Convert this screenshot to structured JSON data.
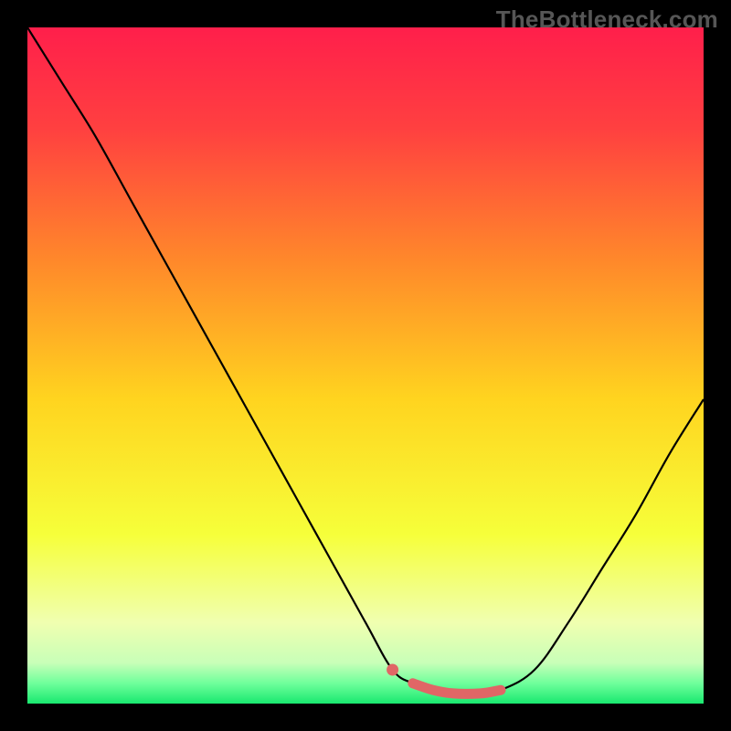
{
  "watermark": "TheBottleneck.com",
  "chart_data": {
    "type": "line",
    "title": "",
    "xlabel": "",
    "ylabel": "",
    "xlim": [
      0,
      100
    ],
    "ylim": [
      0,
      100
    ],
    "grid": false,
    "legend": false,
    "series": [
      {
        "name": "curve",
        "x": [
          0,
          5,
          10,
          15,
          20,
          25,
          30,
          35,
          40,
          45,
          50,
          54,
          57,
          60,
          63,
          67,
          70,
          75,
          80,
          85,
          90,
          95,
          100
        ],
        "values": [
          100,
          92,
          84,
          75,
          66,
          57,
          48,
          39,
          30,
          21,
          12,
          5,
          3,
          2,
          1.5,
          1.5,
          2,
          5,
          12,
          20,
          28,
          37,
          45
        ]
      },
      {
        "name": "marker-dot",
        "x": [
          54
        ],
        "values": [
          5
        ]
      },
      {
        "name": "marker-segment",
        "x": [
          57,
          60,
          63,
          67,
          70
        ],
        "values": [
          3,
          2,
          1.5,
          1.5,
          2
        ]
      }
    ],
    "gradient_stops": [
      {
        "offset": 0,
        "color": "#ff1f4b"
      },
      {
        "offset": 15,
        "color": "#ff4040"
      },
      {
        "offset": 35,
        "color": "#ff8a2a"
      },
      {
        "offset": 55,
        "color": "#ffd41f"
      },
      {
        "offset": 75,
        "color": "#f6ff3a"
      },
      {
        "offset": 88,
        "color": "#f0ffb0"
      },
      {
        "offset": 94,
        "color": "#c8ffb8"
      },
      {
        "offset": 97,
        "color": "#6fff9b"
      },
      {
        "offset": 100,
        "color": "#19e86f"
      }
    ],
    "marker_color": "#e06666"
  }
}
